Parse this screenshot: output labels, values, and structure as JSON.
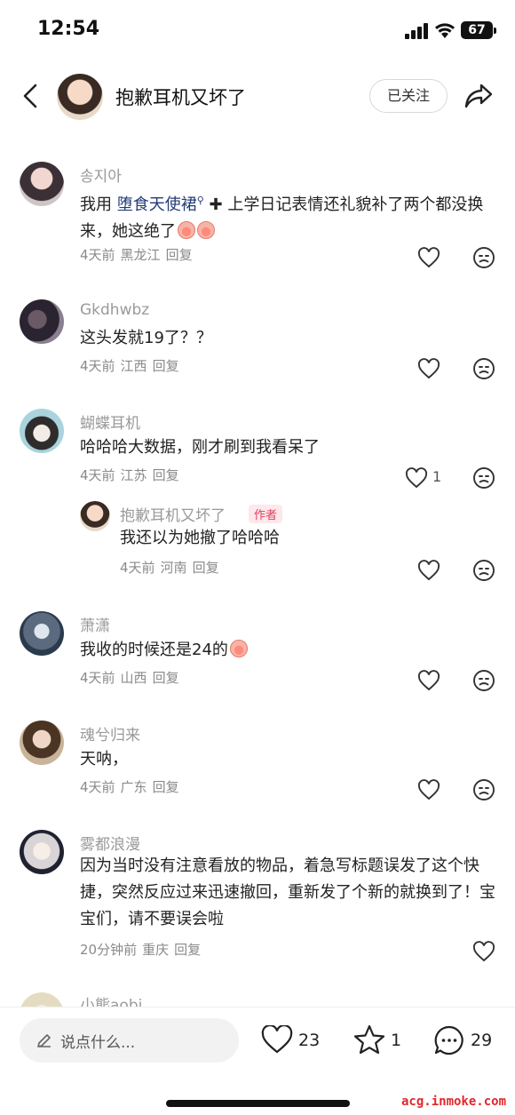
{
  "status_bar": {
    "time": "12:54",
    "battery": "67"
  },
  "header": {
    "title": "抱歉耳机又坏了",
    "follow_label": "已关注"
  },
  "comments": [
    {
      "name": "송지아",
      "text_prefix": "我用 ",
      "tag": "堕食天使裙",
      "text_suffix": " 上学日记表情还礼貌补了两个都没换来，她这绝了",
      "time": "4天前",
      "location": "黑龙江",
      "reply": "回复"
    },
    {
      "name": "Gkdhwbz",
      "text": "这头发就19了？？",
      "time": "4天前",
      "location": "江西",
      "reply": "回复"
    },
    {
      "name": "蝴蝶耳机",
      "text": "哈哈哈大数据，刚才刷到我看呆了",
      "time": "4天前",
      "location": "江苏",
      "reply": "回复",
      "likes": "1"
    },
    {
      "name": "抱歉耳机又坏了",
      "badge": "作者",
      "text": "我还以为她撤了哈哈哈",
      "time": "4天前",
      "location": "河南",
      "reply": "回复"
    },
    {
      "name": "萧潇",
      "text": "我收的时候还是24的",
      "time": "4天前",
      "location": "山西",
      "reply": "回复"
    },
    {
      "name": "魂兮归来",
      "text": "天呐，",
      "time": "4天前",
      "location": "广东",
      "reply": "回复"
    },
    {
      "name": "雾都浪漫",
      "text": "因为当时没有注意看放的物品，着急写标题误发了这个快捷，突然反应过来迅速撤回，重新发了个新的就换到了！宝宝们，请不要误会啦",
      "time": "20分钟前",
      "location": "重庆",
      "reply": "回复"
    },
    {
      "name": "小熊aobi"
    }
  ],
  "bottom_bar": {
    "placeholder": "说点什么...",
    "likes": "23",
    "stars": "1",
    "comments": "29"
  },
  "watermark": "acg.inmoke.com",
  "colors": {
    "tag": "#223c78",
    "author_badge": "#e0405c",
    "watermark": "#e0282c"
  }
}
